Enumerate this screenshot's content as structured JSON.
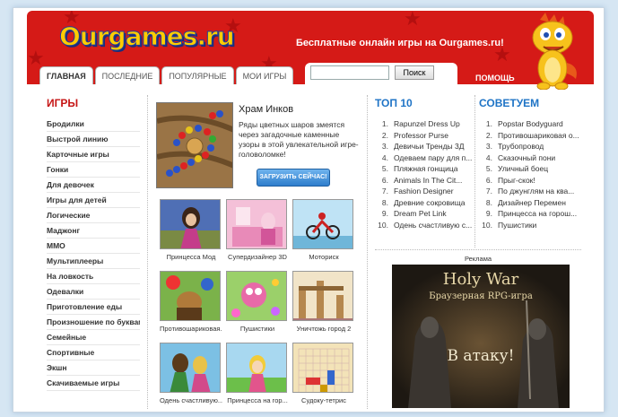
{
  "header": {
    "logo": "Ourgames.ru",
    "tagline": "Бесплатные онлайн игры на Ourgames.ru!",
    "help_label": "ПОМОЩЬ"
  },
  "tabs": [
    {
      "label": "ГЛАВНАЯ"
    },
    {
      "label": "ПОСЛЕДНИЕ"
    },
    {
      "label": "ПОПУЛЯРНЫЕ"
    },
    {
      "label": "МОИ ИГРЫ"
    }
  ],
  "search": {
    "value": "",
    "button_label": "Поиск"
  },
  "categories": {
    "title": "ИГРЫ",
    "items": [
      "Бродилки",
      "Выстрой линию",
      "Карточные игры",
      "Гонки",
      "Для девочек",
      "Игры для детей",
      "Логические",
      "Маджонг",
      "ММО",
      "Мультиплееры",
      "На ловкость",
      "Одевалки",
      "Приготовление еды",
      "Произношение по буквам",
      "Семейные",
      "Спортивные",
      "Экшн",
      "Скачиваемые игры"
    ]
  },
  "featured": {
    "title": "Храм Инков",
    "description": "Ряды цветных шаров змеятся через загадочные каменные узоры в этой увлекательной игре-головоломке!",
    "button_label": "ЗАГРУЗИТЬ СЕЙЧАС!"
  },
  "games": [
    {
      "name": "Принцесса Мод"
    },
    {
      "name": "Супердизайнер 3D"
    },
    {
      "name": "Моториск"
    },
    {
      "name": "Противошариковая..."
    },
    {
      "name": "Пушистики"
    },
    {
      "name": "Уничтожь город 2"
    },
    {
      "name": "Одень счастливую..."
    },
    {
      "name": "Принцесса на гор..."
    },
    {
      "name": "Судоку-тетрис"
    }
  ],
  "top10": {
    "title": "ТОП 10",
    "items": [
      "Rapunzel Dress Up",
      "Professor Purse",
      "Девичьи Тренды 3Д",
      "Одеваем пару для п...",
      "Пляжная гонщица",
      "Animals In The Cit...",
      "Fashion Designer",
      "Древние сокровища",
      "Dream Pet Link",
      "Одень счастливую с..."
    ]
  },
  "recommended": {
    "title": "СОВЕТУЕМ",
    "items": [
      "Popstar Bodyguard",
      "Противошариковая о...",
      "Трубопровод",
      "Сказочный пони",
      "Уличный боец",
      "Прыг-скок!",
      "По джунглям на ква...",
      "Дизайнер Перемен",
      "Принцесса на горош...",
      "Пушистики"
    ]
  },
  "ad": {
    "label": "Реклама",
    "title": "Holy War",
    "subtitle": "Браузерная RPG-игра",
    "cta": "В атаку!"
  }
}
